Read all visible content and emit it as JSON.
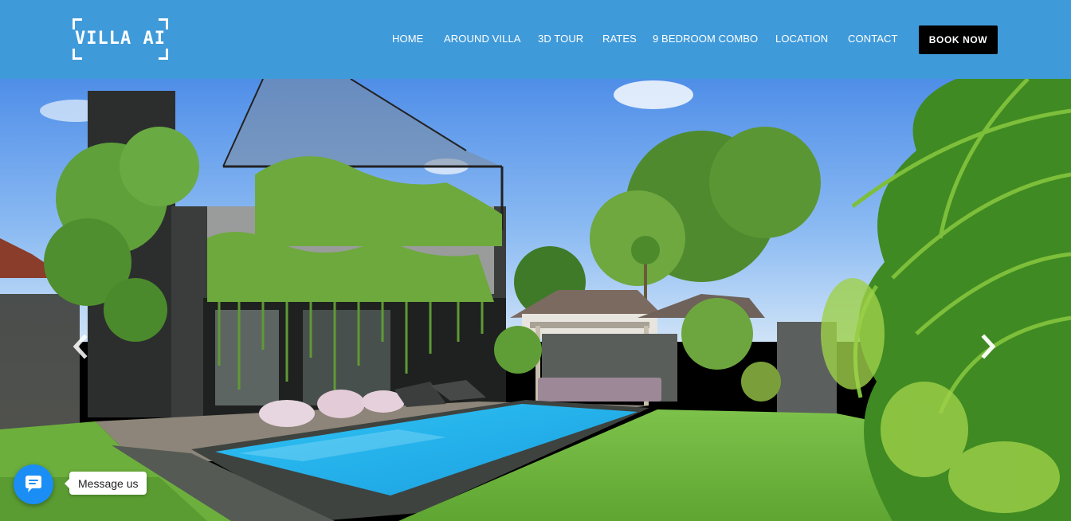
{
  "header": {
    "logo_text": "VILLA AI",
    "bg_color": "#3f9ada",
    "nav": [
      {
        "label": "HOME"
      },
      {
        "label": "AROUND VILLA"
      },
      {
        "label": "3D TOUR"
      },
      {
        "label": "RATES"
      },
      {
        "label": "9 BEDROOM COMBO"
      },
      {
        "label": "LOCATION"
      },
      {
        "label": "CONTACT"
      }
    ],
    "book_button": "BOOK NOW"
  },
  "slider": {
    "prev_icon": "chevron-left-icon",
    "next_icon": "chevron-right-icon"
  },
  "chat_widget": {
    "icon": "messenger-icon",
    "label": "Message us",
    "accent": "#1a8ef5"
  }
}
